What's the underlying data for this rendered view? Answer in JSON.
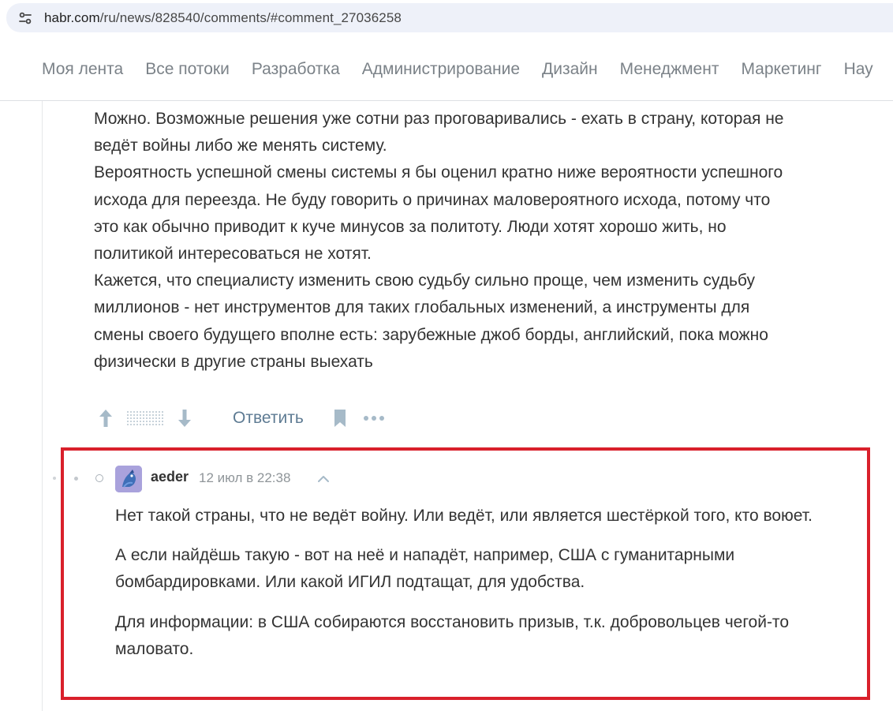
{
  "browser": {
    "url_host": "habr.com",
    "url_path": "/ru/news/828540/comments/#comment_27036258"
  },
  "nav": {
    "items": [
      "Моя лента",
      "Все потоки",
      "Разработка",
      "Администрирование",
      "Дизайн",
      "Менеджмент",
      "Маркетинг",
      "Нау"
    ]
  },
  "parent_comment": {
    "lines": [
      "Можно. Возможные решения уже сотни раз проговаривались - ехать в страну, которая не",
      "ведёт войны либо же менять систему.",
      "Вероятность успешной смены системы я бы оценил кратно ниже вероятности успешного",
      "исхода для переезда. Не буду говорить о причинах маловероятного исхода, потому что",
      "это как обычно приводит к куче минусов за политоту. Люди хотят хорошо жить, но",
      "политикой интересоваться не хотят.",
      "Кажется, что специалисту изменить свою судьбу сильно проще, чем изменить судьбу",
      "миллионов - нет инструментов для таких глобальных изменений, а инструменты для",
      "смены своего будущего вполне есть: зарубежные джоб борды, английский, пока можно",
      "физически в другие страны выехать"
    ],
    "actions": {
      "reply_label": "Ответить"
    }
  },
  "reply_comment": {
    "author": "aeder",
    "date": "12 июл в 22:38",
    "paragraphs": [
      "Нет такой страны, что не ведёт войну. Или ведёт, или является шестёркой того, кто воюет.",
      "А если найдёшь такую - вот на неё и нападёт, например, США с гуманитарными бомбардировками. Или какой ИГИЛ подтащат, для удобства.",
      "Для информации: в США собираются восстановить призыв, т.к. добровольцев чегой-то маловато."
    ]
  },
  "colors": {
    "highlight_border": "#d9202b",
    "nav_text": "#7b8288",
    "link": "#5e7b93",
    "icon": "#a6bac8"
  },
  "icons": {
    "site_info": "tune-icon",
    "upvote": "arrow-up-icon",
    "downvote": "arrow-down-icon",
    "bookmark": "bookmark-icon",
    "more": "more-dots-icon",
    "collapse": "chevron-up-icon"
  }
}
